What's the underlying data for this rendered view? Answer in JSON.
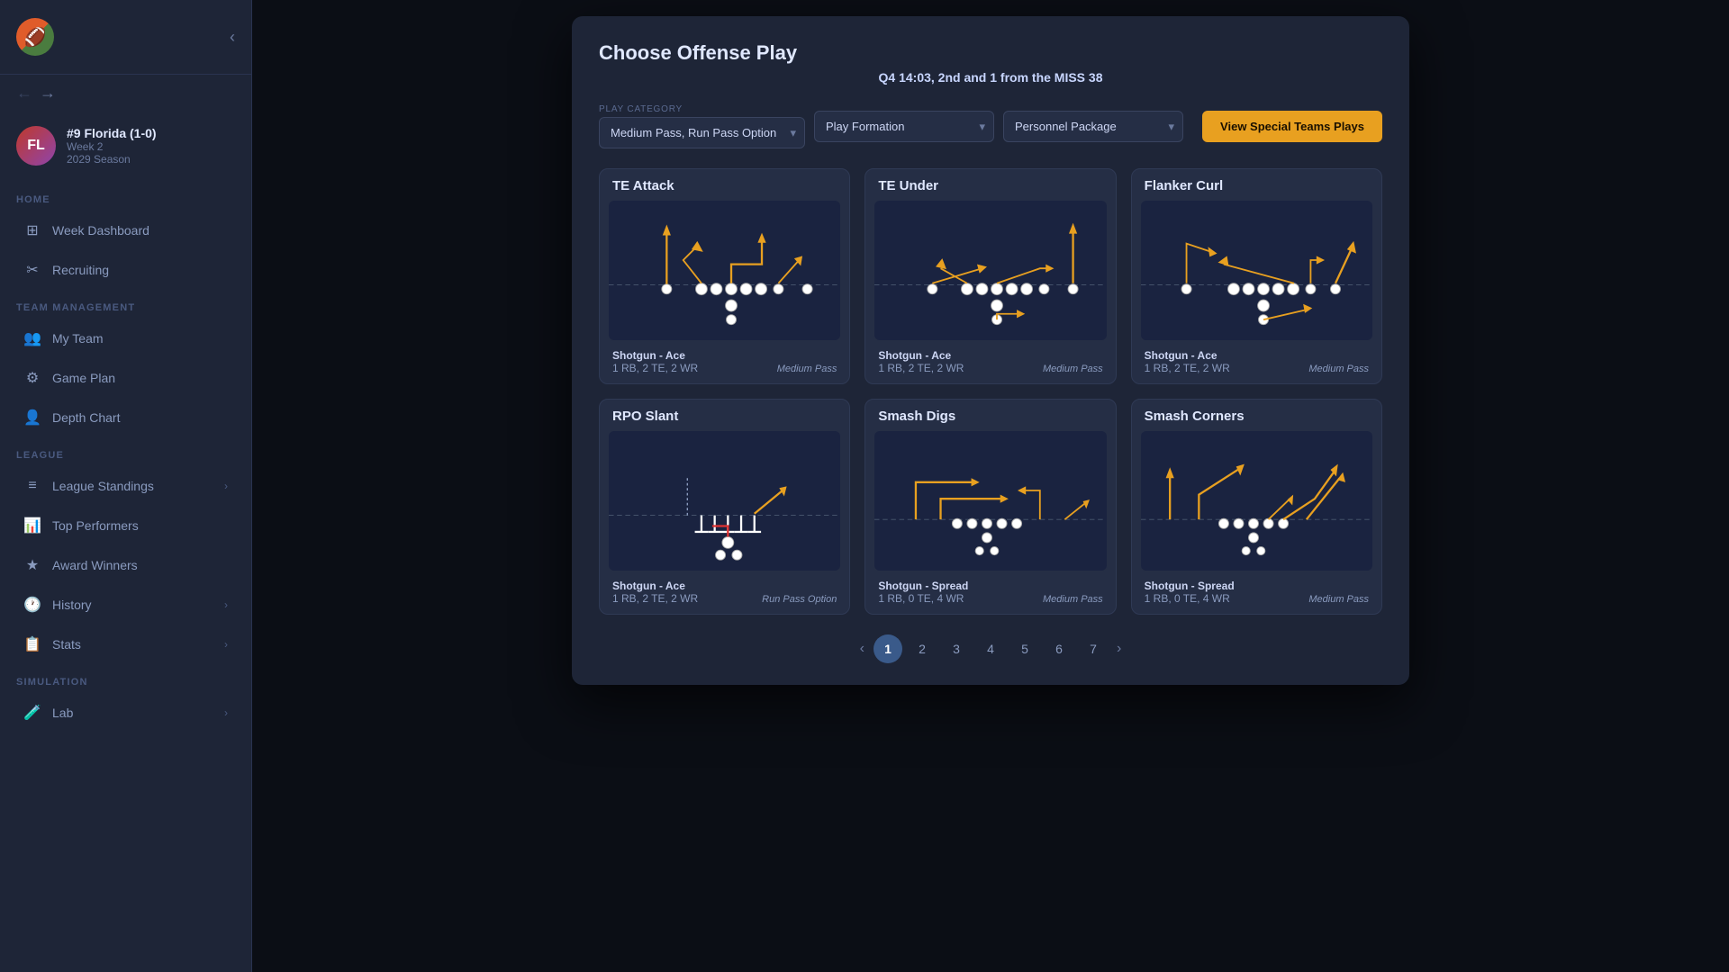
{
  "app": {
    "logo": "🏈"
  },
  "sidebar": {
    "collapse_btn": "‹",
    "team": {
      "initials": "FL",
      "name": "#9 Florida (1-0)",
      "week": "Week 2",
      "season": "2029 Season"
    },
    "sections": [
      {
        "label": "HOME",
        "items": [
          {
            "id": "week-dashboard",
            "label": "Week Dashboard",
            "icon": "⊞",
            "has_chevron": false
          },
          {
            "id": "recruiting",
            "label": "Recruiting",
            "icon": "✂",
            "has_chevron": false
          }
        ]
      },
      {
        "label": "TEAM MANAGEMENT",
        "items": [
          {
            "id": "my-team",
            "label": "My Team",
            "icon": "👥",
            "has_chevron": false
          },
          {
            "id": "game-plan",
            "label": "Game Plan",
            "icon": "⚙",
            "has_chevron": false
          },
          {
            "id": "depth-chart",
            "label": "Depth Chart",
            "icon": "👤",
            "has_chevron": false
          }
        ]
      },
      {
        "label": "LEAGUE",
        "items": [
          {
            "id": "league-standings",
            "label": "League Standings",
            "icon": "≡",
            "has_chevron": true
          },
          {
            "id": "top-performers",
            "label": "Top Performers",
            "icon": "📊",
            "has_chevron": false
          },
          {
            "id": "award-winners",
            "label": "Award Winners",
            "icon": "★",
            "has_chevron": false
          },
          {
            "id": "history",
            "label": "History",
            "icon": "🕐",
            "has_chevron": true
          },
          {
            "id": "stats",
            "label": "Stats",
            "icon": "📋",
            "has_chevron": true
          }
        ]
      },
      {
        "label": "SIMULATION",
        "items": [
          {
            "id": "lab",
            "label": "Lab",
            "icon": "🧪",
            "has_chevron": true
          }
        ]
      }
    ]
  },
  "modal": {
    "title": "Choose Offense Play",
    "subtitle": "Q4 14:03, 2nd and 1 from the MISS 38",
    "filters": {
      "play_category_label": "Play Category",
      "play_category_value": "Medium Pass, Run Pass Option",
      "play_formation_label": "Play Formation",
      "play_formation_placeholder": "Play Formation",
      "personnel_package_placeholder": "Personnel Package",
      "special_teams_btn": "View Special Teams Plays"
    },
    "plays": [
      {
        "id": "te-attack",
        "name": "TE Attack",
        "formation": "Shotgun - Ace",
        "personnel": "1 RB, 2 TE, 2 WR",
        "type": "Medium Pass",
        "diagram": "te_attack"
      },
      {
        "id": "te-under",
        "name": "TE Under",
        "formation": "Shotgun - Ace",
        "personnel": "1 RB, 2 TE, 2 WR",
        "type": "Medium Pass",
        "diagram": "te_under"
      },
      {
        "id": "flanker-curl",
        "name": "Flanker Curl",
        "formation": "Shotgun - Ace",
        "personnel": "1 RB, 2 TE, 2 WR",
        "type": "Medium Pass",
        "diagram": "flanker_curl"
      },
      {
        "id": "rpo-slant",
        "name": "RPO Slant",
        "formation": "Shotgun - Ace",
        "personnel": "1 RB, 2 TE, 2 WR",
        "type": "Run Pass Option",
        "diagram": "rpo_slant"
      },
      {
        "id": "smash-digs",
        "name": "Smash Digs",
        "formation": "Shotgun - Spread",
        "personnel": "1 RB, 0 TE, 4 WR",
        "type": "Medium Pass",
        "diagram": "smash_digs"
      },
      {
        "id": "smash-corners",
        "name": "Smash Corners",
        "formation": "Shotgun - Spread",
        "personnel": "1 RB, 0 TE, 4 WR",
        "type": "Medium Pass",
        "diagram": "smash_corners"
      }
    ],
    "pagination": {
      "current_page": 1,
      "total_pages": 7,
      "pages": [
        1,
        2,
        3,
        4,
        5,
        6,
        7
      ]
    }
  }
}
